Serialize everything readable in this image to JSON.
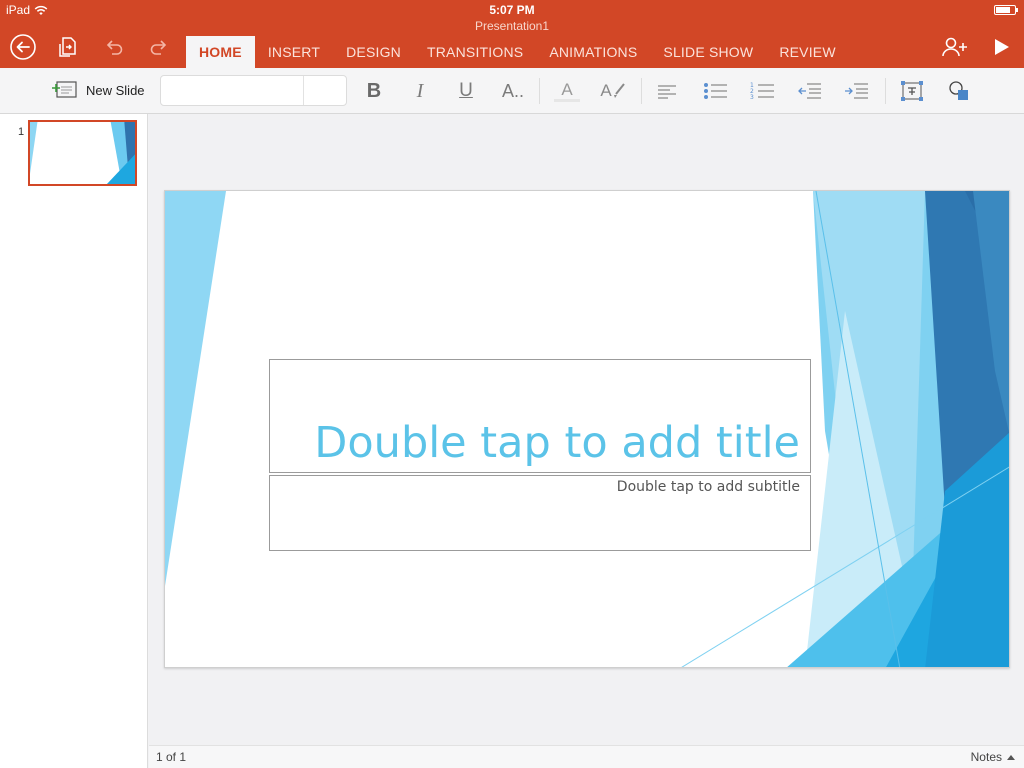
{
  "status": {
    "device": "iPad",
    "time": "5:07 PM",
    "battery_level": 0.75
  },
  "document": {
    "title": "Presentation1"
  },
  "toolbar": {
    "icons": [
      "back-icon",
      "file-icon",
      "undo-icon",
      "redo-icon",
      "add-person-icon",
      "play-icon"
    ]
  },
  "tabs": [
    {
      "label": "HOME",
      "active": true
    },
    {
      "label": "INSERT",
      "active": false
    },
    {
      "label": "DESIGN",
      "active": false
    },
    {
      "label": "TRANSITIONS",
      "active": false
    },
    {
      "label": "ANIMATIONS",
      "active": false
    },
    {
      "label": "SLIDE SHOW",
      "active": false
    },
    {
      "label": "REVIEW",
      "active": false
    }
  ],
  "ribbon": {
    "new_slide_label": "New Slide",
    "font_name": "",
    "font_size": "",
    "bold_glyph": "B",
    "italic_glyph": "I",
    "underline_glyph": "U",
    "more_format_glyph": "A..",
    "font_color_glyph": "A",
    "highlight_glyph": "A"
  },
  "thumbnails": [
    {
      "number": "1",
      "selected": true
    }
  ],
  "slide": {
    "title_placeholder": "Double tap to add title",
    "subtitle_placeholder": "Double tap to add subtitle"
  },
  "footer": {
    "page_count": "1 of 1",
    "notes_label": "Notes"
  },
  "colors": {
    "accent": "#d24726",
    "title_color": "#5bc3e8",
    "theme_light_blue": "#7fd1f1",
    "theme_dark_blue": "#2a6ea8"
  }
}
